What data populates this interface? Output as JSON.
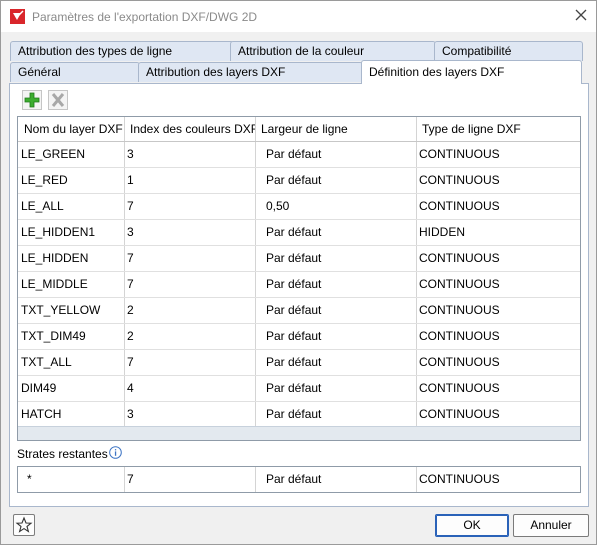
{
  "window": {
    "title": "Paramètres de l'exportation DXF/DWG 2D"
  },
  "tabs_back": [
    "Attribution des types de ligne",
    "Attribution de la couleur",
    "Compatibilité"
  ],
  "tabs_front": [
    "Général",
    "Attribution des layers DXF",
    "Définition des layers DXF"
  ],
  "active_tab": "Définition des layers DXF",
  "toolbar": {
    "add_icon": "green-plus-icon",
    "delete_icon": "grey-x-icon"
  },
  "table": {
    "headers": [
      "Nom du layer DXF",
      "Index des couleurs DXF",
      "Largeur de ligne",
      "Type de ligne DXF"
    ],
    "rows": [
      [
        "LE_GREEN",
        "3",
        "Par défaut",
        "CONTINUOUS"
      ],
      [
        "LE_RED",
        "1",
        "Par défaut",
        "CONTINUOUS"
      ],
      [
        "LE_ALL",
        "7",
        "0,50",
        "CONTINUOUS"
      ],
      [
        "LE_HIDDEN1",
        "3",
        "Par défaut",
        "HIDDEN"
      ],
      [
        "LE_HIDDEN",
        "7",
        "Par défaut",
        "CONTINUOUS"
      ],
      [
        "LE_MIDDLE",
        "7",
        "Par défaut",
        "CONTINUOUS"
      ],
      [
        "TXT_YELLOW",
        "2",
        "Par défaut",
        "CONTINUOUS"
      ],
      [
        "TXT_DIM49",
        "2",
        "Par défaut",
        "CONTINUOUS"
      ],
      [
        "TXT_ALL",
        "7",
        "Par défaut",
        "CONTINUOUS"
      ],
      [
        "DIM49",
        "4",
        "Par défaut",
        "CONTINUOUS"
      ],
      [
        "HATCH",
        "3",
        "Par défaut",
        "CONTINUOUS"
      ]
    ]
  },
  "remaining": {
    "label": "Strates restantes",
    "row": [
      "*",
      "7",
      "Par défaut",
      "CONTINUOUS"
    ]
  },
  "buttons": {
    "ok": "OK",
    "cancel": "Annuler"
  },
  "colors": {
    "accent": "#2a62b8",
    "tab_bg": "#dfe7f3",
    "brand_red": "#d9262b"
  }
}
